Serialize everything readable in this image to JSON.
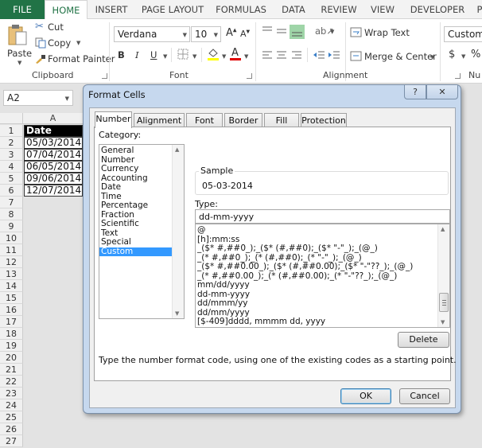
{
  "ribbon_tabs": [
    "FILE",
    "HOME",
    "INSERT",
    "PAGE LAYOUT",
    "FORMULAS",
    "DATA",
    "REVIEW",
    "VIEW",
    "DEVELOPER",
    "P"
  ],
  "active_tab": "HOME",
  "clipboard": {
    "paste_label": "Paste",
    "cut_label": "Cut",
    "copy_label": "Copy",
    "format_painter_label": "Format Painter",
    "group_label": "Clipboard"
  },
  "font": {
    "font_name": "Verdana",
    "font_size": "10",
    "bold": "B",
    "italic": "I",
    "underline": "U",
    "group_label": "Font",
    "fill_color": "#ffff00",
    "font_color": "#e00000"
  },
  "alignment": {
    "wrap_text_label": "Wrap Text",
    "merge_center_label": "Merge & Center",
    "group_label": "Alignment"
  },
  "number": {
    "format_value": "Custom",
    "currency_symbol": "$",
    "percent_symbol": "%",
    "group_label": "Nu"
  },
  "name_box": "A2",
  "sheet": {
    "column_header": "A",
    "rows": [
      "1",
      "2",
      "3",
      "4",
      "5",
      "6",
      "7",
      "8",
      "9",
      "10",
      "11",
      "12",
      "13",
      "14",
      "15",
      "16",
      "17",
      "18",
      "19",
      "20",
      "21",
      "22",
      "23",
      "24",
      "25",
      "26",
      "27"
    ],
    "cells": [
      "Date",
      "05/03/2014",
      "07/04/2014",
      "06/05/2014",
      "09/06/2014",
      "12/07/2014"
    ]
  },
  "dialog": {
    "title": "Format Cells",
    "help_label": "?",
    "close_label": "✕",
    "tabs": [
      "Number",
      "Alignment",
      "Font",
      "Border",
      "Fill",
      "Protection"
    ],
    "active_tab": "Number",
    "category_label": "Category:",
    "categories": [
      "General",
      "Number",
      "Currency",
      "Accounting",
      "Date",
      "Time",
      "Percentage",
      "Fraction",
      "Scientific",
      "Text",
      "Special",
      "Custom"
    ],
    "selected_category": "Custom",
    "sample_label": "Sample",
    "sample_value": "05-03-2014",
    "type_label": "Type:",
    "type_value": "dd-mm-yyyy",
    "type_list": [
      "@",
      "[h]:mm:ss",
      "_($* #,##0_);_($* (#,##0);_($* \"-\"_);_(@_)",
      "_(* #,##0_);_(* (#,##0);_(* \"-\"_);_(@_)",
      "_($* #,##0.00_);_($* (#,##0.00);_($* \"-\"??_);_(@_)",
      "_(* #,##0.00_);_(* (#,##0.00);_(* \"-\"??_);_(@_)",
      "mm/dd/yyyy",
      "dd-mm-yyyy",
      "dd/mmm/yy",
      "dd/mm/yyyy",
      "[$-409]dddd, mmmm dd, yyyy"
    ],
    "delete_label": "Delete",
    "hint": "Type the number format code, using one of the existing codes as a starting point.",
    "ok_label": "OK",
    "cancel_label": "Cancel"
  }
}
